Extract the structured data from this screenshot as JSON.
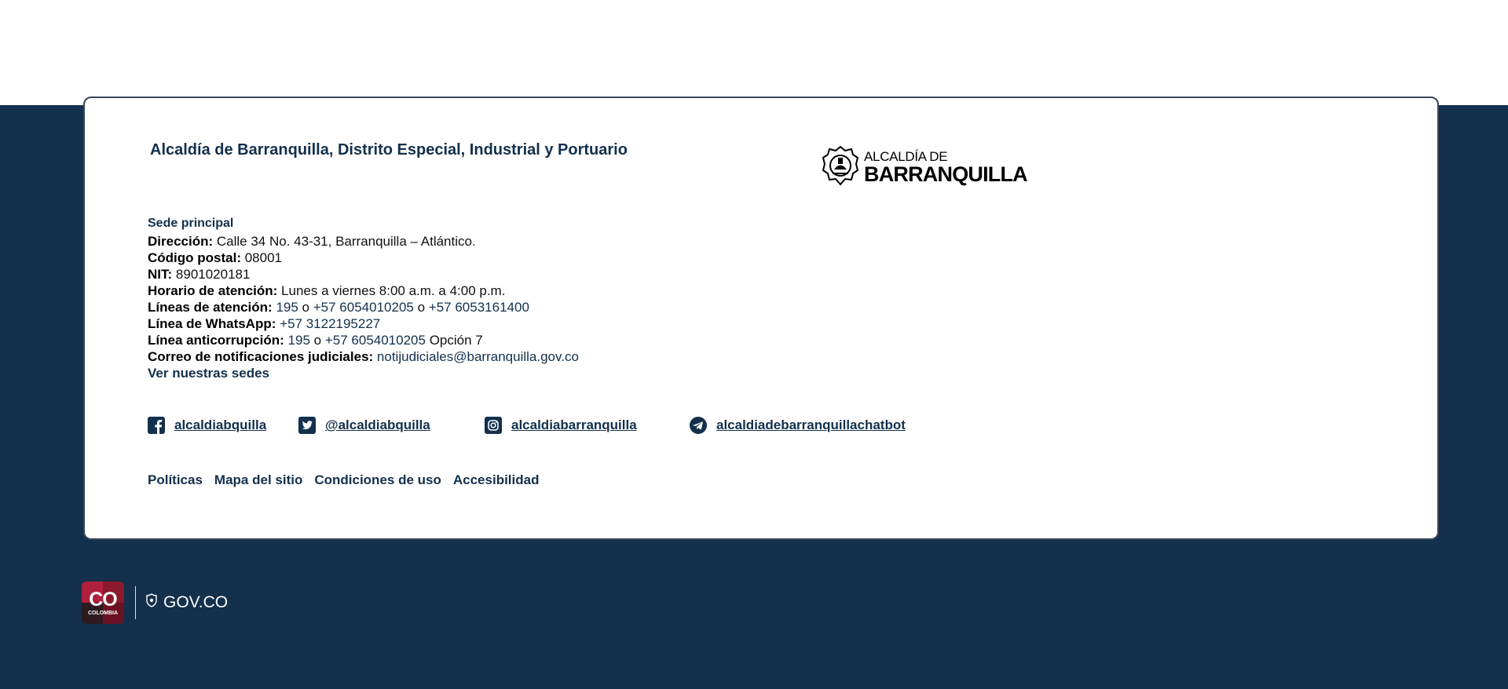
{
  "header": {
    "org_title": "Alcaldía de Barranquilla, Distrito Especial, Industrial y Portuario",
    "logo_line1": "ALCALDÍA DE",
    "logo_line2": "BARRANQUILLA"
  },
  "contact": {
    "sede_heading": "Sede principal",
    "address_label": "Dirección:",
    "address_value": "Calle 34 No. 43-31, Barranquilla –  Atlántico.",
    "postal_label": "Código postal:",
    "postal_value": "08001",
    "nit_label": "NIT:",
    "nit_value": "8901020181",
    "hours_label": "Horario de atención:",
    "hours_value": "Lunes a viernes 8:00 a.m. a 4:00 p.m.",
    "lines_label": "Líneas de atención:",
    "lines_phone1": "195",
    "lines_sep1": "o",
    "lines_phone2": "+57 6054010205",
    "lines_sep2": "o",
    "lines_phone3": "+57 6053161400",
    "whatsapp_label": "Línea de WhatsApp:",
    "whatsapp_value": "+57 3122195227",
    "anticorr_label": "Línea anticorrupción:",
    "anticorr_phone1": "195",
    "anticorr_sep": "o",
    "anticorr_phone2": "+57 6054010205",
    "anticorr_option": "Opción 7",
    "judicial_label": "Correo de notificaciones judiciales:",
    "judicial_email": "notijudiciales@barranquilla.gov.co",
    "see_offices": "Ver nuestras sedes"
  },
  "social": [
    {
      "icon": "facebook-icon",
      "label": "alcaldiabquilla"
    },
    {
      "icon": "twitter-icon",
      "label": "@alcaldiabquilla"
    },
    {
      "icon": "instagram-icon",
      "label": "alcaldiabarranquilla"
    },
    {
      "icon": "telegram-icon",
      "label": "alcaldiadebarranquillachatbot"
    }
  ],
  "footer_links": [
    "Políticas",
    "Mapa del sitio",
    "Condiciones de uso",
    "Accesibilidad"
  ],
  "gov": {
    "badge_main": "CO",
    "badge_sub": "COLOMBIA",
    "portal": "GOV.CO"
  },
  "colors": {
    "navy": "#13304c",
    "card_border": "#3b4757",
    "badge_red": "#8b1a2d"
  }
}
